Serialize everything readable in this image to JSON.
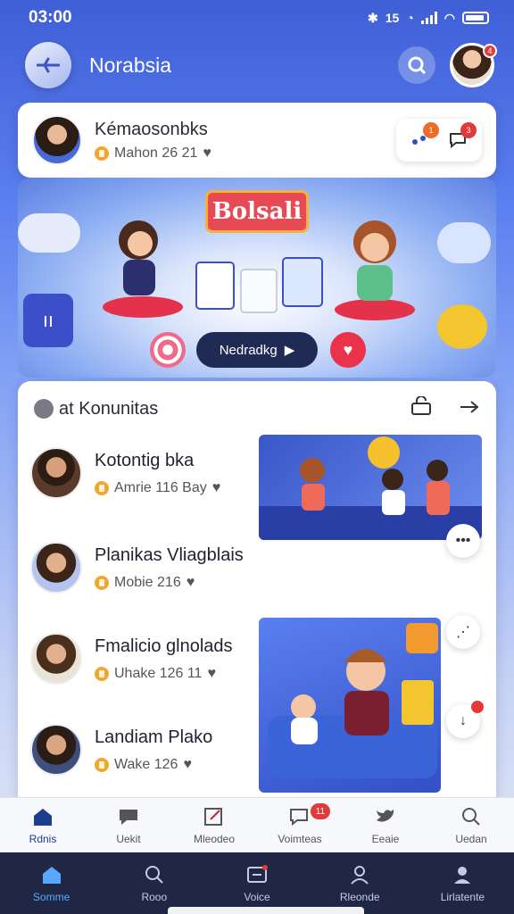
{
  "status_bar": {
    "time": "03:00",
    "network": "15"
  },
  "header": {
    "title": "Norabsia",
    "avatar_badge": "4"
  },
  "profile_card": {
    "name": "Kémaosonbks",
    "meta": "Mahon 26 21",
    "action1_badge": "1",
    "action2_badge": "3"
  },
  "banner": {
    "title": "Bolsali",
    "button_label": "Nedradkg"
  },
  "feed": {
    "title": "at Konunitas",
    "items": [
      {
        "name": "Kotontig bka",
        "meta": "Amrie 116 Bay"
      },
      {
        "name": "Planikas Vliagblais",
        "meta": "Mobie 216"
      },
      {
        "name": "Fmalicio glnolads",
        "meta": "Uhake 126 11"
      },
      {
        "name": "Landiam Plako",
        "meta": "Wake 126"
      }
    ]
  },
  "tabs_top": [
    {
      "label": "Rdnis"
    },
    {
      "label": "Uekit"
    },
    {
      "label": "Mleodeo"
    },
    {
      "label": "Voimteas",
      "badge": "11"
    },
    {
      "label": "Eeaie"
    },
    {
      "label": "Uedan"
    }
  ],
  "tabs_bottom": [
    {
      "label": "Somme"
    },
    {
      "label": "Rooo"
    },
    {
      "label": "Voice"
    },
    {
      "label": "Rleonde"
    },
    {
      "label": "Lirlatente"
    }
  ],
  "colors": {
    "accent": "#3f5fd6",
    "badge": "#e23a3a",
    "dark_nav": "#1f2745",
    "active_tab": "#58a8ff"
  }
}
